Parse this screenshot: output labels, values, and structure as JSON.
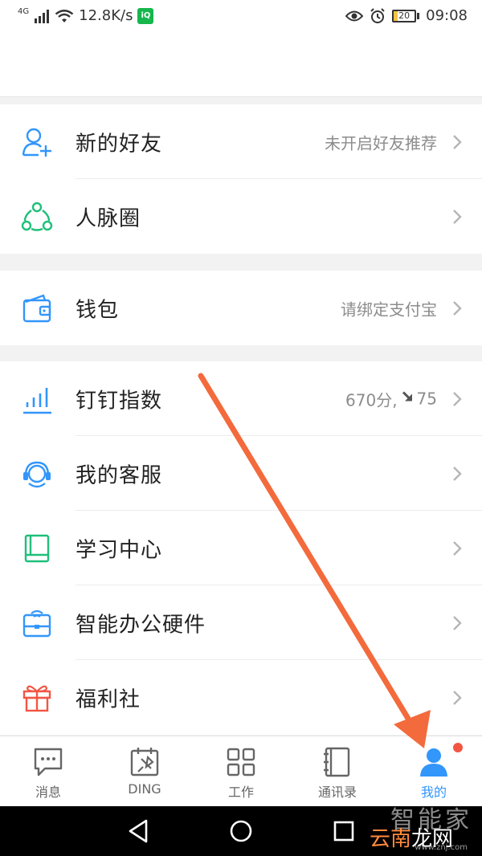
{
  "status_bar": {
    "network": "4G",
    "speed": "12.8K/s",
    "app_badge": "iQIYI",
    "battery": "20",
    "time": "09:08"
  },
  "groups": [
    {
      "items": [
        {
          "label": "新的好友",
          "value": "未开启好友推荐",
          "icon": "add-friend-icon"
        },
        {
          "label": "人脉圈",
          "value": "",
          "icon": "network-circle-icon"
        }
      ]
    },
    {
      "items": [
        {
          "label": "钱包",
          "value": "请绑定支付宝",
          "icon": "wallet-icon"
        }
      ]
    },
    {
      "items": [
        {
          "label": "钉钉指数",
          "value_score": "670分,",
          "value_delta": "75",
          "icon": "bar-chart-icon"
        },
        {
          "label": "我的客服",
          "value": "",
          "icon": "headset-icon"
        },
        {
          "label": "学习中心",
          "value": "",
          "icon": "book-icon"
        },
        {
          "label": "智能办公硬件",
          "value": "",
          "icon": "smart-hardware-icon"
        },
        {
          "label": "福利社",
          "value": "",
          "icon": "gift-icon"
        }
      ]
    }
  ],
  "tabs": [
    {
      "label": "消息",
      "icon": "message-icon",
      "active": false
    },
    {
      "label": "DING",
      "icon": "ding-icon",
      "active": false
    },
    {
      "label": "工作",
      "icon": "grid-icon",
      "active": false
    },
    {
      "label": "通讯录",
      "icon": "contacts-icon",
      "active": false
    },
    {
      "label": "我的",
      "icon": "user-icon",
      "active": true
    }
  ],
  "watermark": {
    "line1": "智能家",
    "line2a": "云南",
    "line2b": "龙网",
    "line3": "www.znj.com"
  },
  "colors": {
    "accent": "#3296fa",
    "green": "#1fbf7a",
    "red": "#f25643",
    "arrow": "#f36a3c"
  }
}
